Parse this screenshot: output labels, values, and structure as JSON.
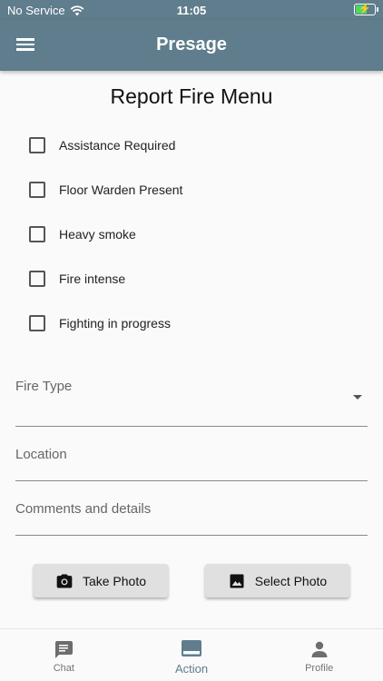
{
  "statusbar": {
    "carrier": "No Service",
    "time": "11:05"
  },
  "appbar": {
    "title": "Presage"
  },
  "page": {
    "title": "Report Fire Menu"
  },
  "checkboxes": [
    {
      "label": "Assistance Required",
      "checked": false
    },
    {
      "label": "Floor Warden Present",
      "checked": false
    },
    {
      "label": "Heavy smoke",
      "checked": false
    },
    {
      "label": "Fire intense",
      "checked": false
    },
    {
      "label": "Fighting in progress",
      "checked": false
    }
  ],
  "fields": {
    "fire_type": {
      "label": "Fire Type",
      "value": ""
    },
    "location": {
      "label": "Location",
      "value": ""
    },
    "comments": {
      "label": "Comments and details",
      "value": ""
    }
  },
  "buttons": {
    "take_photo": "Take Photo",
    "select_photo": "Select Photo"
  },
  "nav": {
    "items": [
      {
        "label": "Chat",
        "icon": "chat-icon",
        "active": false
      },
      {
        "label": "Action",
        "icon": "action-icon",
        "active": true
      },
      {
        "label": "Profile",
        "icon": "profile-icon",
        "active": false
      }
    ]
  },
  "colors": {
    "primary": "#5f7d8c",
    "battery": "#4cd964"
  }
}
